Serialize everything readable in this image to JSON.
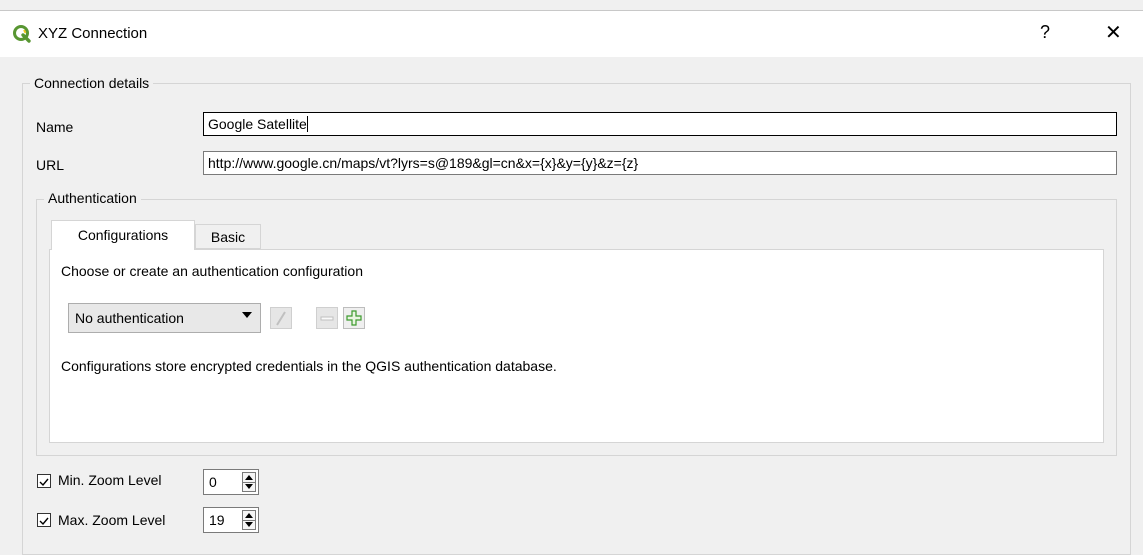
{
  "window": {
    "title": "XYZ Connection",
    "help_label": "?",
    "close_label": "✕",
    "app_icon": "qgis-logo-icon",
    "app_icon_color": "#589632"
  },
  "connection_details": {
    "title": "Connection details",
    "name_label": "Name",
    "name_value": "Google Satellite",
    "url_label": "URL",
    "url_value": "http://www.google.cn/maps/vt?lyrs=s@189&gl=cn&x={x}&y={y}&z={z}"
  },
  "authentication": {
    "title": "Authentication",
    "tabs": [
      {
        "label": "Configurations",
        "active": true
      },
      {
        "label": "Basic",
        "active": false
      }
    ],
    "prompt": "Choose or create an authentication configuration",
    "selected_config": "No authentication",
    "buttons": [
      {
        "icon": "edit-pencil-icon",
        "enabled": false
      },
      {
        "icon": "remove-minus-icon",
        "enabled": false
      },
      {
        "icon": "add-plus-icon",
        "enabled": true
      }
    ],
    "info": "Configurations store encrypted credentials in the QGIS authentication database."
  },
  "zoom": {
    "min_label": "Min. Zoom Level",
    "min_checked": true,
    "min_value": "0",
    "max_label": "Max. Zoom Level",
    "max_checked": true,
    "max_value": "19"
  }
}
